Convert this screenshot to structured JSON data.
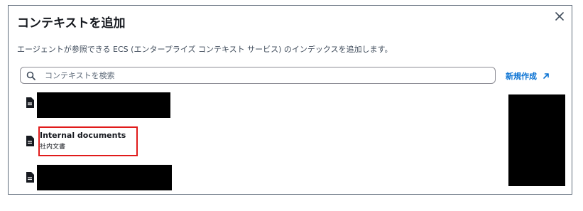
{
  "dialog": {
    "title": "コンテキストを追加",
    "description": "エージェントが参照できる ECS (エンタープライズ コンテキスト サービス) のインデックスを追加します。",
    "close_icon": "close-icon"
  },
  "search": {
    "placeholder": "コンテキストを検索",
    "value": "",
    "icon": "search-icon"
  },
  "new_link": {
    "label": "新規作成",
    "icon": "external-arrow-icon",
    "color": "#0972d3"
  },
  "list": {
    "items": [
      {
        "name": "",
        "subtitle": "",
        "redacted": true,
        "icon": "document-icon"
      },
      {
        "name": "Internal documents",
        "subtitle": "社内文書",
        "redacted": false,
        "icon": "document-icon",
        "highlighted": true
      },
      {
        "name": "",
        "subtitle": "",
        "redacted": true,
        "icon": "document-icon"
      }
    ]
  },
  "colors": {
    "highlight": "#e01b1b",
    "redaction": "#000000",
    "link": "#0972d3"
  }
}
